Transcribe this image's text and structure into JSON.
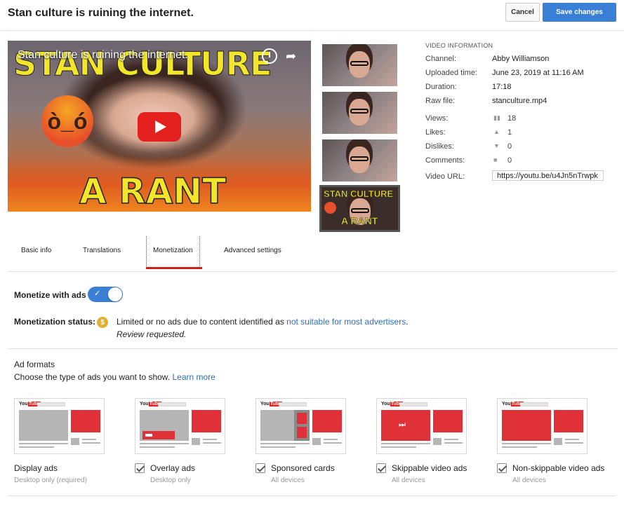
{
  "header": {
    "title": "Stan culture is ruining the internet.",
    "cancel_label": "Cancel",
    "save_label": "Save changes"
  },
  "player": {
    "overlay_title": "Stan culture is ruining the internet.",
    "thumbnail_headline": "STAN CULTURE",
    "thumbnail_subline": "A RANT"
  },
  "thumbnails": {
    "selected_headline": "STAN CULTURE",
    "selected_subline": "A RANT"
  },
  "video_info": {
    "heading": "VIDEO INFORMATION",
    "channel_label": "Channel:",
    "channel_value": "Abby Williamson",
    "uploaded_label": "Uploaded time:",
    "uploaded_value": "June 23, 2019 at 11:16 AM",
    "duration_label": "Duration:",
    "duration_value": "17:18",
    "rawfile_label": "Raw file:",
    "rawfile_value": "stanculture.mp4",
    "views_label": "Views:",
    "views_value": "18",
    "likes_label": "Likes:",
    "likes_value": "1",
    "dislikes_label": "Dislikes:",
    "dislikes_value": "0",
    "comments_label": "Comments:",
    "comments_value": "0",
    "url_label": "Video URL:",
    "url_value": "https://youtu.be/u4Jn5nTrwpk"
  },
  "tabs": {
    "basic": "Basic info",
    "translations": "Translations",
    "monetization": "Monetization",
    "advanced": "Advanced settings"
  },
  "monetization": {
    "monetize_label": "Monetize with ads",
    "monetize_enabled": true,
    "status_label": "Monetization status:",
    "status_text": "Limited or no ads due to content identified as ",
    "status_link": "not suitable for most advertisers",
    "status_suffix": ".",
    "review_text": "Review requested."
  },
  "ad_formats": {
    "title": "Ad formats",
    "description": "Choose the type of ads you want to show. ",
    "learn_more": "Learn more",
    "items": [
      {
        "name": "Display ads",
        "sub": "Desktop only (required)",
        "checked": false
      },
      {
        "name": "Overlay ads",
        "sub": "Desktop only",
        "checked": true
      },
      {
        "name": "Sponsored cards",
        "sub": "All devices",
        "checked": true
      },
      {
        "name": "Skippable video ads",
        "sub": "All devices",
        "checked": true
      },
      {
        "name": "Non-skippable video ads",
        "sub": "All devices",
        "checked": true
      }
    ],
    "logo_text_1": "You",
    "logo_text_2": "Tube"
  },
  "colors": {
    "accent_blue": "#3a7fd6",
    "youtube_red": "#e4201e",
    "tab_underline": "#cc1f1f",
    "link": "#2e6db5"
  }
}
